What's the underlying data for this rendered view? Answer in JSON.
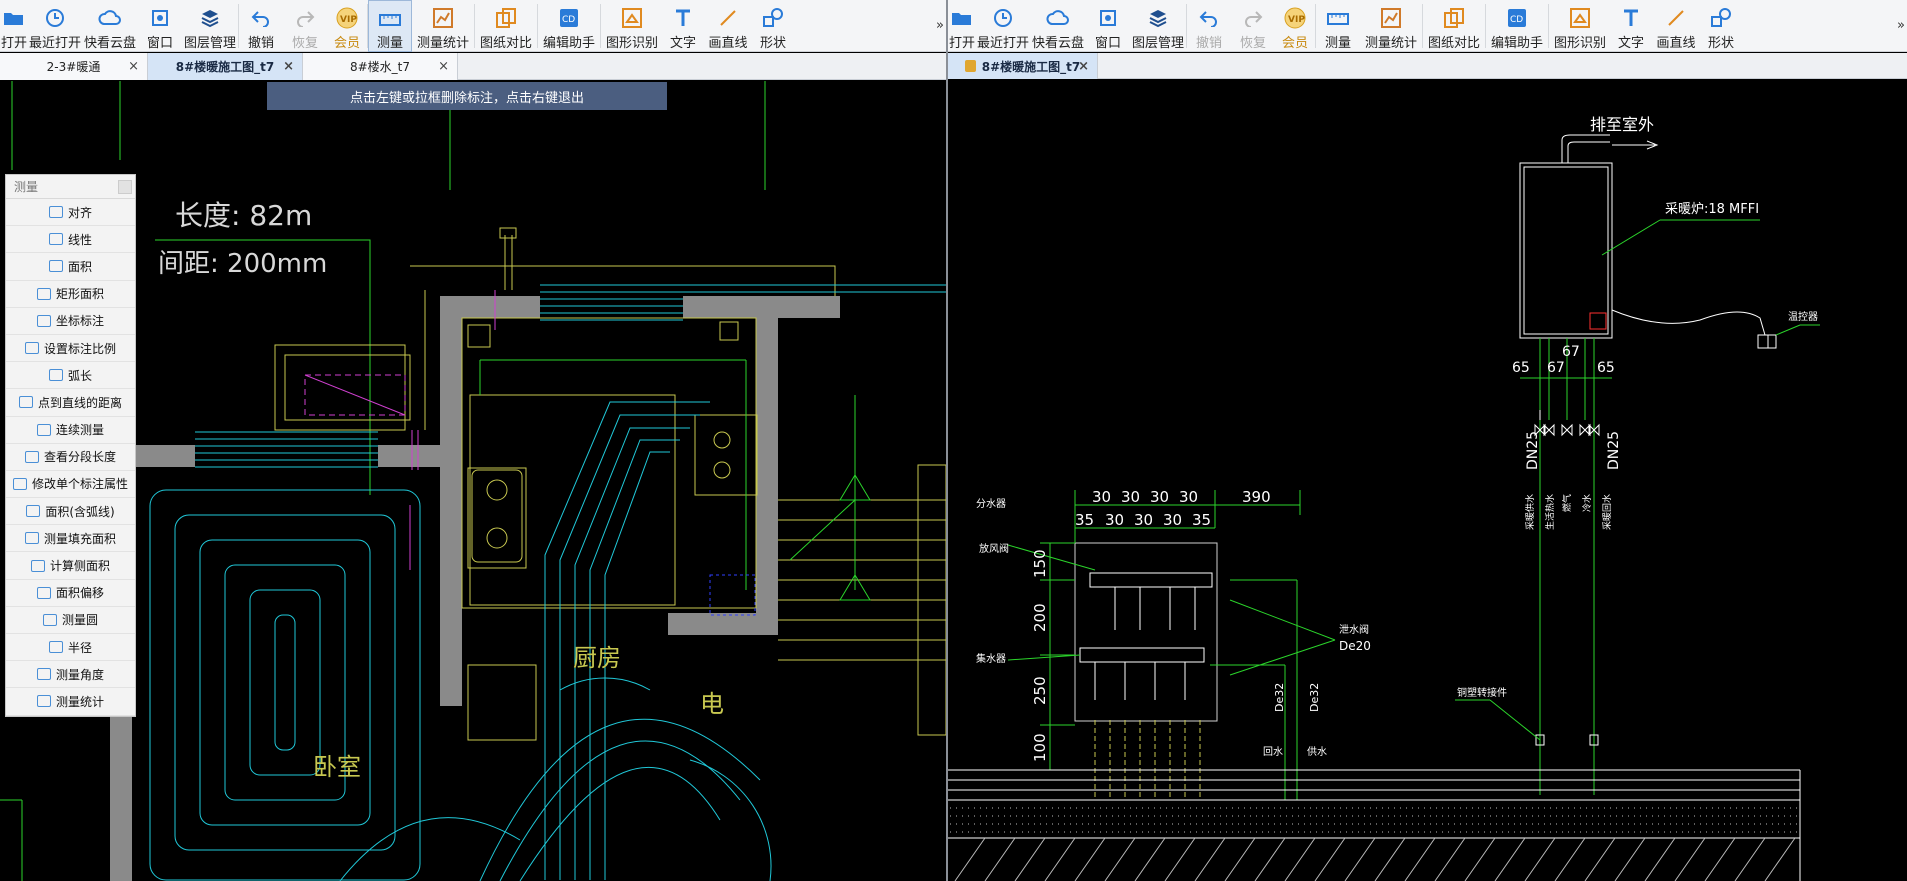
{
  "left": {
    "toolbar": [
      {
        "label": "打开",
        "icon": "folder-open-icon"
      },
      {
        "label": "最近打开",
        "icon": "recent-clock-icon"
      },
      {
        "label": "快看云盘",
        "icon": "cloud-icon"
      },
      {
        "label": "窗口",
        "icon": "window-icon"
      },
      {
        "label": "图层管理",
        "icon": "layers-icon"
      },
      {
        "label": "撤销",
        "icon": "undo-icon"
      },
      {
        "label": "恢复",
        "icon": "redo-icon"
      },
      {
        "label": "会员",
        "icon": "vip-icon"
      },
      {
        "label": "测量",
        "icon": "measure-icon"
      },
      {
        "label": "测量统计",
        "icon": "measure-stats-icon"
      },
      {
        "label": "图纸对比",
        "icon": "compare-icon"
      },
      {
        "label": "编辑助手",
        "icon": "edit-helper-icon"
      },
      {
        "label": "图形识别",
        "icon": "shape-recognize-icon"
      },
      {
        "label": "文字",
        "icon": "text-icon"
      },
      {
        "label": "画直线",
        "icon": "line-icon"
      },
      {
        "label": "形状",
        "icon": "shape-icon"
      }
    ],
    "more": "»",
    "tabs": [
      {
        "label": "2-3#暖通",
        "close": "×"
      },
      {
        "label": "8#楼暖施工图_t7",
        "close": "×"
      },
      {
        "label": "8#楼水_t7",
        "close": "×"
      }
    ],
    "hint": "点击左键或拉框删除标注，点击右键退出",
    "measure_readout": {
      "length": "长度: 82m",
      "spacing": "间距: 200mm"
    },
    "room_labels": {
      "kitchen": "厨房",
      "bedroom": "卧室",
      "electric": "电"
    },
    "panel": {
      "title": "测量",
      "items": [
        "对齐",
        "线性",
        "面积",
        "矩形面积",
        "坐标标注",
        "设置标注比例",
        "弧长",
        "点到直线的距离",
        "连续测量",
        "查看分段长度",
        "修改单个标注属性",
        "面积(含弧线)",
        "测量填充面积",
        "计算侧面积",
        "面积偏移",
        "测量圆",
        "半径",
        "测量角度",
        "测量统计"
      ]
    }
  },
  "right": {
    "toolbar": [
      {
        "label": "打开",
        "icon": "folder-open-icon"
      },
      {
        "label": "最近打开",
        "icon": "recent-clock-icon"
      },
      {
        "label": "快看云盘",
        "icon": "cloud-icon"
      },
      {
        "label": "窗口",
        "icon": "window-icon"
      },
      {
        "label": "图层管理",
        "icon": "layers-icon"
      },
      {
        "label": "撤销",
        "icon": "undo-icon"
      },
      {
        "label": "恢复",
        "icon": "redo-icon"
      },
      {
        "label": "会员",
        "icon": "vip-icon"
      },
      {
        "label": "测量",
        "icon": "measure-icon"
      },
      {
        "label": "测量统计",
        "icon": "measure-stats-icon"
      },
      {
        "label": "图纸对比",
        "icon": "compare-icon"
      },
      {
        "label": "编辑助手",
        "icon": "edit-helper-icon"
      },
      {
        "label": "图形识别",
        "icon": "shape-recognize-icon"
      },
      {
        "label": "文字",
        "icon": "text-icon"
      },
      {
        "label": "画直线",
        "icon": "line-icon"
      },
      {
        "label": "形状",
        "icon": "shape-icon"
      }
    ],
    "more": "»",
    "tab": {
      "label": "8#楼暖施工图_t7",
      "close": "×"
    },
    "drawing": {
      "exhaust": "排至室外",
      "boiler": "采暖炉:18 MFFI",
      "thermostat": "温控器",
      "dim_65a": "65",
      "dim_67a": "67",
      "dim_67b": "67",
      "dim_65b": "65",
      "dn25a": "DN25",
      "dn25b": "DN25",
      "pipe_labels": [
        "采暖供水",
        "生活热水",
        "燃气",
        "冷水",
        "采暖回水"
      ],
      "dims_top": [
        "30",
        "30",
        "30",
        "30",
        "390"
      ],
      "dims_second": [
        "35",
        "30",
        "30",
        "30",
        "35"
      ],
      "dims_left": [
        "150",
        "200",
        "250",
        "100"
      ],
      "distributor": "分水器",
      "vent_valve": "放风阀",
      "collector": "集水器",
      "drain_valve": "泄水阀",
      "de20": "De20",
      "de32a": "De32",
      "de32b": "De32",
      "return": "回水",
      "supply": "供水",
      "connector": "铜塑转接件"
    }
  },
  "colors": {
    "cad_bg": "#000000",
    "toolbar_bg": "#f4f5f7",
    "accent": "#2a7bd8",
    "hint_bg": "#4b5e80"
  }
}
